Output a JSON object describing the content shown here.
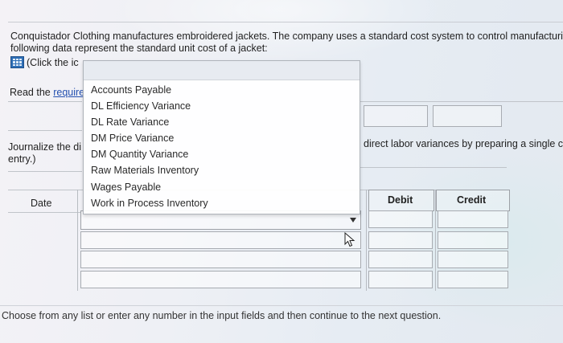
{
  "question": {
    "intro_line1": "Conquistador Clothing manufactures embroidered jackets. The company uses a standard cost system to control manufacturin",
    "intro_line2": "following data represent the standard unit cost of a jacket:",
    "click_hint": "(Click the ic",
    "read_prefix": "Read the ",
    "read_link": "require",
    "journalize_left_line1": "Journalize the di",
    "journalize_left_line2": "entry.)",
    "journalize_right": "direct labor variances by preparing a single c"
  },
  "journal_table": {
    "date_header": "Date",
    "debit_header": "Debit",
    "credit_header": "Credit"
  },
  "account_dropdown": {
    "selected": "",
    "options": [
      "Accounts Payable",
      "DL Efficiency Variance",
      "DL Rate Variance",
      "DM Price Variance",
      "DM Quantity Variance",
      "Raw Materials Inventory",
      "Wages Payable",
      "Work in Process Inventory"
    ]
  },
  "footer": {
    "message": "Choose from any list or enter any number in the input fields and then continue to the next question."
  }
}
